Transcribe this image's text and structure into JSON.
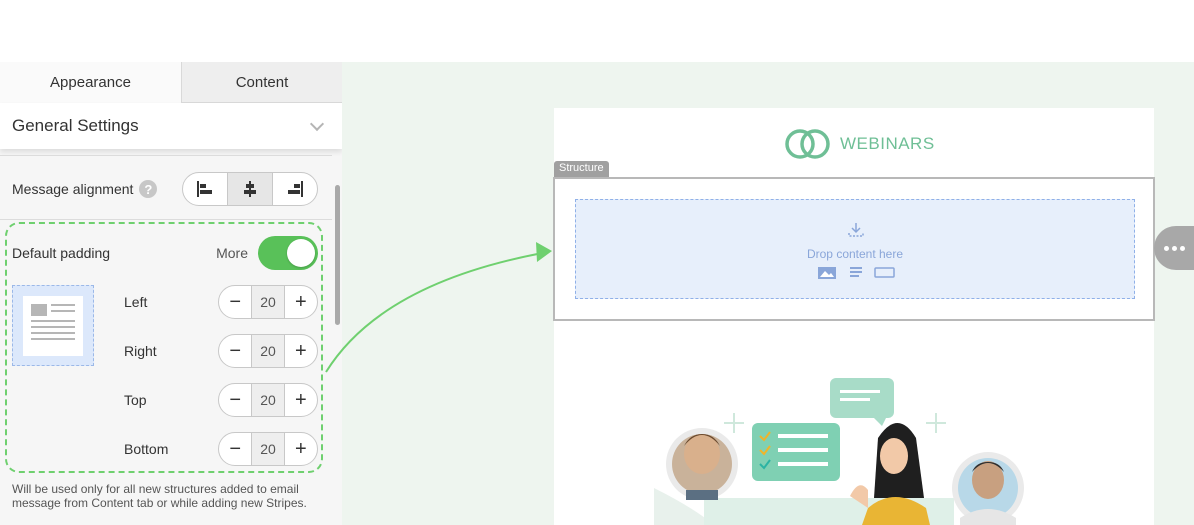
{
  "tabs": {
    "appearance": "Appearance",
    "content": "Content"
  },
  "general_settings": {
    "title": "General Settings"
  },
  "message_alignment": {
    "label": "Message alignment",
    "help": "?",
    "selected": "center"
  },
  "default_padding": {
    "label": "Default padding",
    "more": "More",
    "toggle_on": true,
    "fields": {
      "left": {
        "label": "Left",
        "value": "20"
      },
      "right": {
        "label": "Right",
        "value": "20"
      },
      "top": {
        "label": "Top",
        "value": "20"
      },
      "bottom": {
        "label": "Bottom",
        "value": "20"
      }
    },
    "minus": "−",
    "plus": "+"
  },
  "note": "Will be used only for all new structures added to email message from Content tab or while adding new Stripes.",
  "canvas": {
    "logo_text": "WEBINARS",
    "structure_tag": "Structure",
    "drop_text": "Drop content here"
  },
  "colors": {
    "toggle": "#59c159",
    "annotation": "#6fd06f",
    "logo": "#6fbf96",
    "drop_zone": "#e7effb"
  }
}
